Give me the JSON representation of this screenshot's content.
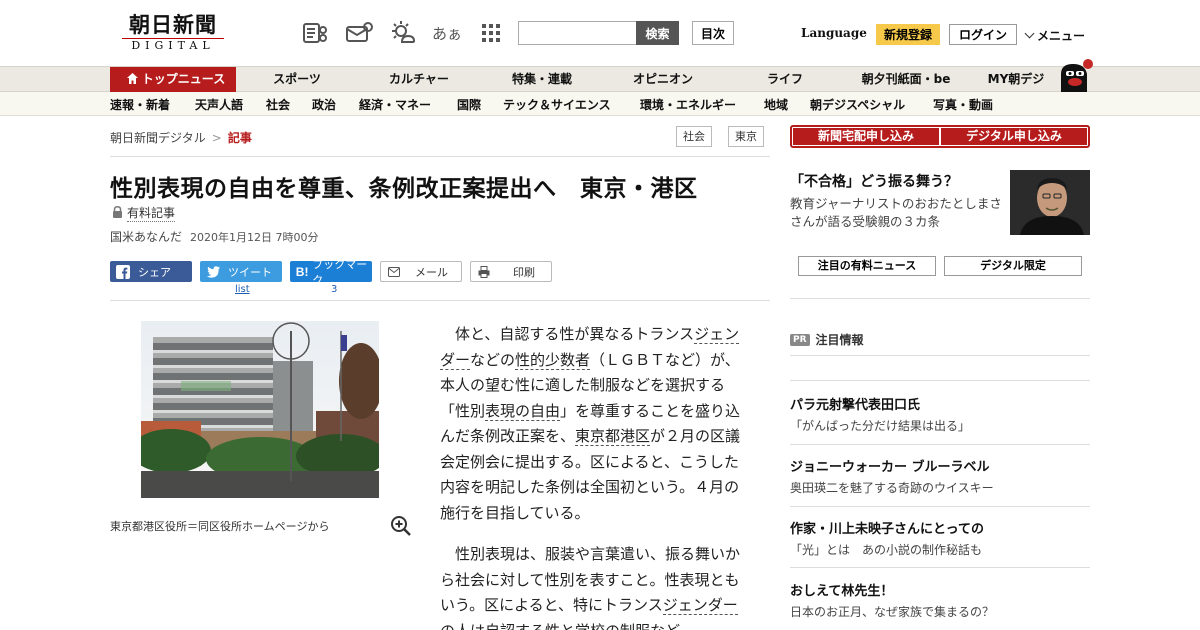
{
  "header": {
    "logo_main": "朝日新聞",
    "logo_sub": "DIGITAL",
    "icons": [
      "newspaper-icon",
      "tv-mail-icon",
      "weather-icon",
      "font-size-icon",
      "apps-grid-icon"
    ],
    "font_size_glyph": "あぁ",
    "search_label": "検索",
    "index_label": "目次",
    "language_label": "Language",
    "register_label": "新規登録",
    "login_label": "ログイン",
    "menu_label": "メニュー"
  },
  "main_nav": {
    "items": [
      {
        "label": "トップニュース",
        "active": true
      },
      {
        "label": "スポーツ"
      },
      {
        "label": "カルチャー"
      },
      {
        "label": "特集・連載"
      },
      {
        "label": "オピニオン"
      },
      {
        "label": "ライフ"
      },
      {
        "label": "朝夕刊紙面・be"
      },
      {
        "label": "MY朝デジ"
      }
    ]
  },
  "sub_nav": {
    "items": [
      "速報・新着",
      "天声人語",
      "社会",
      "政治",
      "経済・マネー",
      "国際",
      "テック＆サイエンス",
      "環境・エネルギー",
      "地域",
      "朝デジスペシャル",
      "写真・動画"
    ]
  },
  "article": {
    "breadcrumb_home": "朝日新聞デジタル",
    "breadcrumb_sep": ">",
    "breadcrumb_current": "記事",
    "tags": [
      "社会",
      "東京"
    ],
    "headline": "性別表現の自由を尊重、条例改正案提出へ　東京・港区",
    "paid_label": "有料記事",
    "author": "国米あなんだ",
    "date": "2020年1月12日 7時00分",
    "share": {
      "facebook": "シェア",
      "twitter": "ツイート",
      "twitter_count": "list",
      "hatena": "ブックマーク",
      "hatena_count": "3",
      "mail": "メール",
      "print": "印刷"
    },
    "caption": "東京都港区役所＝同区役所ホームページから",
    "p1": {
      "a": "体と、自認する性が異なるトランス",
      "l1": "ジェンダー",
      "b": "などの",
      "l2": "性的少数者",
      "c": "（ＬＧＢＴなど）が、本人の望む性に適した制服などを選択する「性別",
      "l3": "表現の自由",
      "d": "」を尊重することを盛り込んだ条例改正案を、",
      "l4": "東京都港区",
      "e": "が２月の区議会定例会に提出する。区によると、こうした内容を明記した条例は全国初という。４月の施行を目指している。"
    },
    "p2": {
      "a": "性別表現は、服装や言葉遣い、振る舞いから社会に対して性別を表すこと。性表現ともいう。区によると、特にトランス",
      "l1": "ジェンダー",
      "b": "の人は自認する性と学校の制服など"
    }
  },
  "sidebar": {
    "subscribe_paper": "新聞宅配申し込み",
    "subscribe_digital": "デジタル申し込み",
    "promo_title": "「不合格」どう振る舞う？",
    "promo_desc": "教育ジャーナリストのおおたとしまささんが語る受験親の３カ条",
    "tab_paid": "注目の有料ニュース",
    "tab_digital": "デジタル限定",
    "pr_badge": "PR",
    "pr_heading": "注目情報",
    "pr_items": [
      {
        "title": "パラ元射撃代表田口氏",
        "sub": "「がんばった分だけ結果は出る」"
      },
      {
        "title": "ジョニーウォーカー ブルーラベル",
        "sub": "奥田瑛二を魅了する奇跡のウイスキー"
      },
      {
        "title": "作家・川上未映子さんにとっての",
        "sub": "「光」とは　あの小説の制作秘話も"
      },
      {
        "title": "おしえて林先生！",
        "sub": "日本のお正月、なぜ家族で集まるの？"
      }
    ]
  },
  "colors": {
    "accent_red": "#b71c1c",
    "register_yellow": "#f6c94a",
    "facebook_blue": "#3b5a98",
    "twitter_blue": "#3d9be0",
    "hatena_blue": "#1c7fd6"
  }
}
